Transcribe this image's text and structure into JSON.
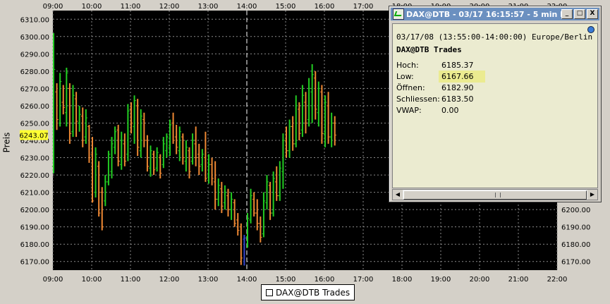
{
  "chart_data": {
    "type": "candlestick",
    "xlabel": "",
    "ylabel": "Preis",
    "x_ticks": [
      "09:00",
      "10:00",
      "11:00",
      "12:00",
      "13:00",
      "14:00",
      "15:00",
      "16:00",
      "17:00",
      "18:00",
      "19:00",
      "20:00",
      "21:00",
      "22:00"
    ],
    "y_ticks": [
      "6310.00",
      "6300.00",
      "6290.00",
      "6280.00",
      "6270.00",
      "6260.00",
      "6250.00",
      "6240.00",
      "6230.00",
      "6220.00",
      "6210.00",
      "6200.00",
      "6190.00",
      "6180.00",
      "6170.00"
    ],
    "y_ticks_right": [
      "6200.00",
      "6190.00",
      "6180.00",
      "6170.00"
    ],
    "ylim": [
      6165,
      6315
    ],
    "x_range_hours": [
      9,
      22
    ],
    "current_price_label": "6243.07",
    "marker_time": "14:00",
    "legend": "DAX@DTB Trades",
    "colors": {
      "up": "#22cc22",
      "down": "#ee8833",
      "marker": "#3344cc",
      "grid": "#8a8a8a",
      "background": "#000000",
      "price_flag": "#ffff33"
    },
    "bars": [
      {
        "t": "09:00",
        "low": 6221,
        "high": 6302,
        "open": 6225,
        "close": 6281
      },
      {
        "t": "09:05",
        "low": 6246,
        "high": 6273,
        "open": 6268,
        "close": 6252
      },
      {
        "t": "09:10",
        "low": 6248,
        "high": 6279,
        "open": 6250,
        "close": 6274
      },
      {
        "t": "09:15",
        "low": 6255,
        "high": 6272,
        "open": 6262,
        "close": 6259
      },
      {
        "t": "09:20",
        "low": 6248,
        "high": 6282,
        "open": 6256,
        "close": 6279
      },
      {
        "t": "09:25",
        "low": 6238,
        "high": 6273,
        "open": 6270,
        "close": 6244
      },
      {
        "t": "09:30",
        "low": 6242,
        "high": 6272,
        "open": 6245,
        "close": 6266
      },
      {
        "t": "09:35",
        "low": 6242,
        "high": 6268,
        "open": 6264,
        "close": 6251
      },
      {
        "t": "09:40",
        "low": 6245,
        "high": 6260,
        "open": 6250,
        "close": 6255
      },
      {
        "t": "09:45",
        "low": 6236,
        "high": 6259,
        "open": 6254,
        "close": 6240
      },
      {
        "t": "09:50",
        "low": 6238,
        "high": 6258,
        "open": 6242,
        "close": 6253
      },
      {
        "t": "09:55",
        "low": 6227,
        "high": 6249,
        "open": 6248,
        "close": 6230
      },
      {
        "t": "10:00",
        "low": 6204,
        "high": 6242,
        "open": 6232,
        "close": 6205
      },
      {
        "t": "10:05",
        "low": 6207,
        "high": 6236,
        "open": 6210,
        "close": 6232
      },
      {
        "t": "10:10",
        "low": 6196,
        "high": 6228,
        "open": 6225,
        "close": 6198
      },
      {
        "t": "10:15",
        "low": 6188,
        "high": 6213,
        "open": 6210,
        "close": 6190
      },
      {
        "t": "10:20",
        "low": 6202,
        "high": 6220,
        "open": 6205,
        "close": 6216
      },
      {
        "t": "10:25",
        "low": 6214,
        "high": 6234,
        "open": 6216,
        "close": 6232
      },
      {
        "t": "10:30",
        "low": 6218,
        "high": 6242,
        "open": 6222,
        "close": 6238
      },
      {
        "t": "10:35",
        "low": 6232,
        "high": 6248,
        "open": 6236,
        "close": 6245
      },
      {
        "t": "10:40",
        "low": 6225,
        "high": 6249,
        "open": 6246,
        "close": 6228
      },
      {
        "t": "10:45",
        "low": 6223,
        "high": 6245,
        "open": 6226,
        "close": 6240
      },
      {
        "t": "10:50",
        "low": 6225,
        "high": 6244,
        "open": 6238,
        "close": 6228
      },
      {
        "t": "10:55",
        "low": 6228,
        "high": 6261,
        "open": 6232,
        "close": 6257
      },
      {
        "t": "11:00",
        "low": 6244,
        "high": 6262,
        "open": 6258,
        "close": 6250
      },
      {
        "t": "11:05",
        "low": 6238,
        "high": 6266,
        "open": 6248,
        "close": 6263
      },
      {
        "t": "11:10",
        "low": 6231,
        "high": 6264,
        "open": 6260,
        "close": 6236
      },
      {
        "t": "11:15",
        "low": 6230,
        "high": 6258,
        "open": 6234,
        "close": 6254
      },
      {
        "t": "11:20",
        "low": 6236,
        "high": 6256,
        "open": 6252,
        "close": 6240
      },
      {
        "t": "11:25",
        "low": 6222,
        "high": 6243,
        "open": 6240,
        "close": 6225
      },
      {
        "t": "11:30",
        "low": 6219,
        "high": 6237,
        "open": 6224,
        "close": 6234
      },
      {
        "t": "11:35",
        "low": 6220,
        "high": 6234,
        "open": 6232,
        "close": 6223
      },
      {
        "t": "11:40",
        "low": 6222,
        "high": 6236,
        "open": 6224,
        "close": 6233
      },
      {
        "t": "11:45",
        "low": 6218,
        "high": 6232,
        "open": 6230,
        "close": 6221
      },
      {
        "t": "11:50",
        "low": 6224,
        "high": 6242,
        "open": 6226,
        "close": 6238
      },
      {
        "t": "11:55",
        "low": 6230,
        "high": 6244,
        "open": 6234,
        "close": 6242
      },
      {
        "t": "12:00",
        "low": 6231,
        "high": 6252,
        "open": 6236,
        "close": 6249
      },
      {
        "t": "12:05",
        "low": 6238,
        "high": 6256,
        "open": 6250,
        "close": 6240
      },
      {
        "t": "12:10",
        "low": 6232,
        "high": 6249,
        "open": 6242,
        "close": 6236
      },
      {
        "t": "12:15",
        "low": 6228,
        "high": 6248,
        "open": 6234,
        "close": 6245
      },
      {
        "t": "12:20",
        "low": 6226,
        "high": 6244,
        "open": 6242,
        "close": 6230
      },
      {
        "t": "12:25",
        "low": 6222,
        "high": 6240,
        "open": 6228,
        "close": 6236
      },
      {
        "t": "12:30",
        "low": 6218,
        "high": 6236,
        "open": 6234,
        "close": 6222
      },
      {
        "t": "12:35",
        "low": 6226,
        "high": 6244,
        "open": 6228,
        "close": 6240
      },
      {
        "t": "12:40",
        "low": 6225,
        "high": 6248,
        "open": 6238,
        "close": 6230
      },
      {
        "t": "12:45",
        "low": 6220,
        "high": 6238,
        "open": 6232,
        "close": 6225
      },
      {
        "t": "12:50",
        "low": 6222,
        "high": 6235,
        "open": 6226,
        "close": 6232
      },
      {
        "t": "12:55",
        "low": 6216,
        "high": 6245,
        "open": 6230,
        "close": 6218
      },
      {
        "t": "13:00",
        "low": 6215,
        "high": 6232,
        "open": 6220,
        "close": 6226
      },
      {
        "t": "13:05",
        "low": 6214,
        "high": 6230,
        "open": 6226,
        "close": 6218
      },
      {
        "t": "13:10",
        "low": 6200,
        "high": 6228,
        "open": 6216,
        "close": 6206
      },
      {
        "t": "13:15",
        "low": 6202,
        "high": 6218,
        "open": 6206,
        "close": 6214
      },
      {
        "t": "13:20",
        "low": 6198,
        "high": 6216,
        "open": 6212,
        "close": 6202
      },
      {
        "t": "13:25",
        "low": 6200,
        "high": 6214,
        "open": 6204,
        "close": 6210
      },
      {
        "t": "13:30",
        "low": 6196,
        "high": 6212,
        "open": 6208,
        "close": 6200
      },
      {
        "t": "13:35",
        "low": 6194,
        "high": 6210,
        "open": 6200,
        "close": 6206
      },
      {
        "t": "13:40",
        "low": 6190,
        "high": 6206,
        "open": 6204,
        "close": 6192
      },
      {
        "t": "13:45",
        "low": 6185,
        "high": 6198,
        "open": 6194,
        "close": 6188
      },
      {
        "t": "13:50",
        "low": 6168,
        "high": 6192,
        "open": 6190,
        "close": 6172
      },
      {
        "t": "13:55",
        "low": 6167.66,
        "high": 6185.37,
        "open": 6182.9,
        "close": 6183.5
      },
      {
        "t": "14:00",
        "low": 6178,
        "high": 6198,
        "open": 6184,
        "close": 6195
      },
      {
        "t": "14:05",
        "low": 6192,
        "high": 6212,
        "open": 6194,
        "close": 6208
      },
      {
        "t": "14:10",
        "low": 6196,
        "high": 6210,
        "open": 6206,
        "close": 6198
      },
      {
        "t": "14:15",
        "low": 6188,
        "high": 6206,
        "open": 6198,
        "close": 6192
      },
      {
        "t": "14:20",
        "low": 6181,
        "high": 6196,
        "open": 6192,
        "close": 6184
      },
      {
        "t": "14:25",
        "low": 6184,
        "high": 6210,
        "open": 6186,
        "close": 6205
      },
      {
        "t": "14:30",
        "low": 6200,
        "high": 6220,
        "open": 6204,
        "close": 6216
      },
      {
        "t": "14:35",
        "low": 6194,
        "high": 6216,
        "open": 6214,
        "close": 6198
      },
      {
        "t": "14:40",
        "low": 6196,
        "high": 6222,
        "open": 6198,
        "close": 6218
      },
      {
        "t": "14:45",
        "low": 6205,
        "high": 6225,
        "open": 6216,
        "close": 6208
      },
      {
        "t": "14:50",
        "low": 6205,
        "high": 6228,
        "open": 6208,
        "close": 6224
      },
      {
        "t": "14:55",
        "low": 6212,
        "high": 6244,
        "open": 6222,
        "close": 6240
      },
      {
        "t": "15:00",
        "low": 6230,
        "high": 6248,
        "open": 6240,
        "close": 6234
      },
      {
        "t": "15:05",
        "low": 6230,
        "high": 6252,
        "open": 6234,
        "close": 6248
      },
      {
        "t": "15:10",
        "low": 6234,
        "high": 6254,
        "open": 6248,
        "close": 6238
      },
      {
        "t": "15:15",
        "low": 6236,
        "high": 6266,
        "open": 6238,
        "close": 6260
      },
      {
        "t": "15:20",
        "low": 6240,
        "high": 6262,
        "open": 6258,
        "close": 6244
      },
      {
        "t": "15:25",
        "low": 6242,
        "high": 6272,
        "open": 6246,
        "close": 6266
      },
      {
        "t": "15:30",
        "low": 6244,
        "high": 6268,
        "open": 6262,
        "close": 6250
      },
      {
        "t": "15:35",
        "low": 6248,
        "high": 6276,
        "open": 6252,
        "close": 6270
      },
      {
        "t": "15:40",
        "low": 6250,
        "high": 6284,
        "open": 6268,
        "close": 6278
      },
      {
        "t": "15:45",
        "low": 6252,
        "high": 6280,
        "open": 6276,
        "close": 6258
      },
      {
        "t": "15:50",
        "low": 6248,
        "high": 6274,
        "open": 6256,
        "close": 6270
      },
      {
        "t": "15:55",
        "low": 6238,
        "high": 6272,
        "open": 6268,
        "close": 6244
      },
      {
        "t": "16:00",
        "low": 6236,
        "high": 6266,
        "open": 6244,
        "close": 6262
      },
      {
        "t": "16:05",
        "low": 6238,
        "high": 6268,
        "open": 6260,
        "close": 6242
      },
      {
        "t": "16:10",
        "low": 6236,
        "high": 6256,
        "open": 6242,
        "close": 6250
      },
      {
        "t": "16:15",
        "low": 6237,
        "high": 6254,
        "open": 6250,
        "close": 6243.07
      }
    ]
  },
  "window": {
    "title": "DAX@DTB - 03/17 16:15:57 - 5 min B...",
    "minimize_label": "_",
    "maximize_label": "□",
    "close_label": "X",
    "time_range": "03/17/08 (13:55:00-14:00:00) Europe/Berlin",
    "instrument": "DAX@DTB Trades",
    "fields": [
      {
        "label": "Hoch:",
        "value": "6185.37"
      },
      {
        "label": "Low:",
        "value": "6167.66"
      },
      {
        "label": "Öffnen:",
        "value": "6182.90"
      },
      {
        "label": "Schliessen:",
        "value": "6183.50"
      },
      {
        "label": "VWAP:",
        "value": "0.00"
      }
    ],
    "scroll_left_icon": "arrow-left-icon",
    "scroll_right_icon": "arrow-right-icon"
  }
}
